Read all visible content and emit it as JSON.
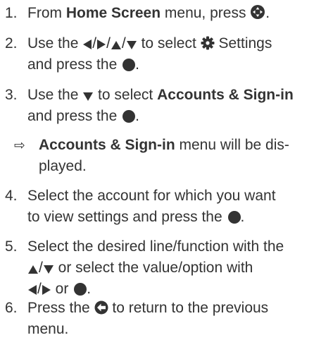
{
  "steps": [
    {
      "number": "1.",
      "t1": "From ",
      "b1": "Home Screen",
      "t2": " menu, press ",
      "t3": "."
    },
    {
      "number": "2.",
      "t1": "Use the ",
      "t2": " to select ",
      "t3": " Settings",
      "t4": "and press the ",
      "t5": "."
    },
    {
      "number": "3.",
      "t1": "Use the ",
      "t2": " to select ",
      "b1": "Accounts & Sign-in",
      "t3": "and press the ",
      "t4": "."
    },
    {
      "number": "4.",
      "t1": "Select the account for which you want",
      "t2": "to view settings and press the ",
      "t3": "."
    },
    {
      "number": "5.",
      "t1": "Select the desired line/function with the",
      "t2": " or select the value/option with",
      "t3": " or ",
      "t4": "."
    },
    {
      "number": "6.",
      "t1": "Press the ",
      "t2": " to return to the previous",
      "t3": "menu."
    }
  ],
  "note": {
    "arrow": "⇨",
    "b1": "Accounts & Sign-in",
    "t1": " menu will be dis-",
    "t2": "played."
  },
  "icons": {
    "slash": "/",
    "color": "#333333"
  }
}
